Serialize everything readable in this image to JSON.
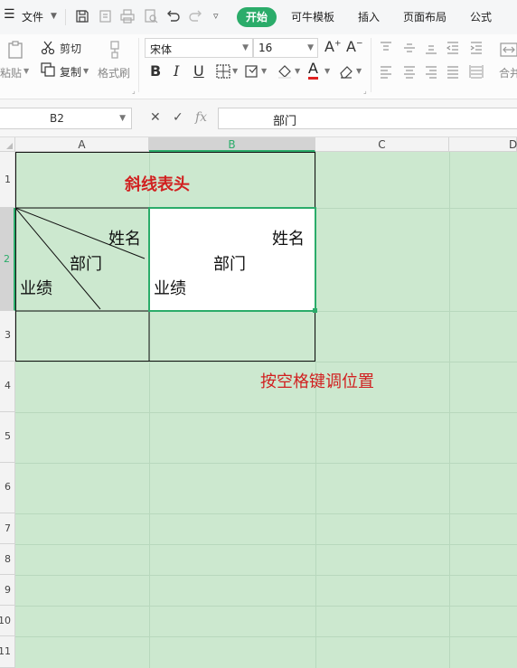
{
  "menu": {
    "file": "文件",
    "tabs": [
      "开始",
      "可牛模板",
      "插入",
      "页面布局",
      "公式"
    ]
  },
  "ribbon": {
    "paste": "粘贴",
    "cut": "剪切",
    "copy": "复制",
    "format_painter": "格式刷",
    "font_name": "宋体",
    "font_size": "16",
    "merge": "合并"
  },
  "formula_bar": {
    "name_box": "B2",
    "fx": "fx",
    "content": "部门"
  },
  "columns": [
    "A",
    "B",
    "C",
    "D"
  ],
  "rows": [
    "1",
    "2",
    "3",
    "4",
    "5",
    "6",
    "7",
    "8",
    "9",
    "10",
    "11"
  ],
  "sheet": {
    "title": "斜线表头",
    "a2_name": "姓名",
    "a2_dept": "部门",
    "a2_perf": "业绩",
    "b2_name": "姓名",
    "b2_dept": "部门",
    "b2_perf": "业绩",
    "note": "按空格键调位置"
  },
  "colors": {
    "accent": "#2bac6a",
    "sheet_bg": "#cce8cf",
    "red_text": "#d12020"
  }
}
